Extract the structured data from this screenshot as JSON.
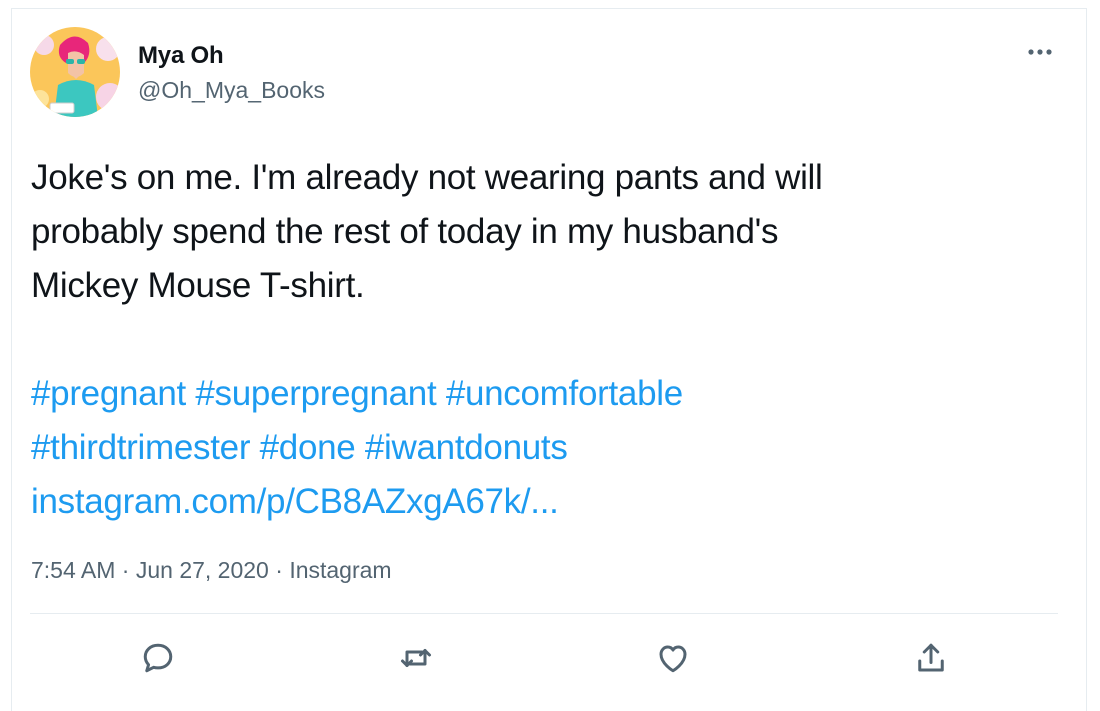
{
  "tweet": {
    "author": {
      "name": "Mya Oh",
      "handle": "@Oh_Mya_Books"
    },
    "text_lines": [
      "Joke's on me. I'm already not wearing pants and will",
      "probably spend the rest of today in my husband's",
      "Mickey Mouse T-shirt."
    ],
    "hashtags_line1": [
      "#pregnant",
      "#superpregnant",
      "#uncomfortable"
    ],
    "hashtags_line2": [
      "#thirdtrimester",
      "#done",
      "#iwantdonuts"
    ],
    "link": "instagram.com/p/CB8AZxgA67k/...",
    "time": "7:54 AM",
    "date": "Jun 27, 2020",
    "source": "Instagram",
    "separator": "·"
  },
  "actions": {
    "reply_icon": "reply-icon",
    "retweet_icon": "retweet-icon",
    "like_icon": "heart-icon",
    "share_icon": "share-icon"
  },
  "colors": {
    "link": "#1d9bf0",
    "secondary_text": "#536471",
    "border": "#e6ecf0"
  }
}
